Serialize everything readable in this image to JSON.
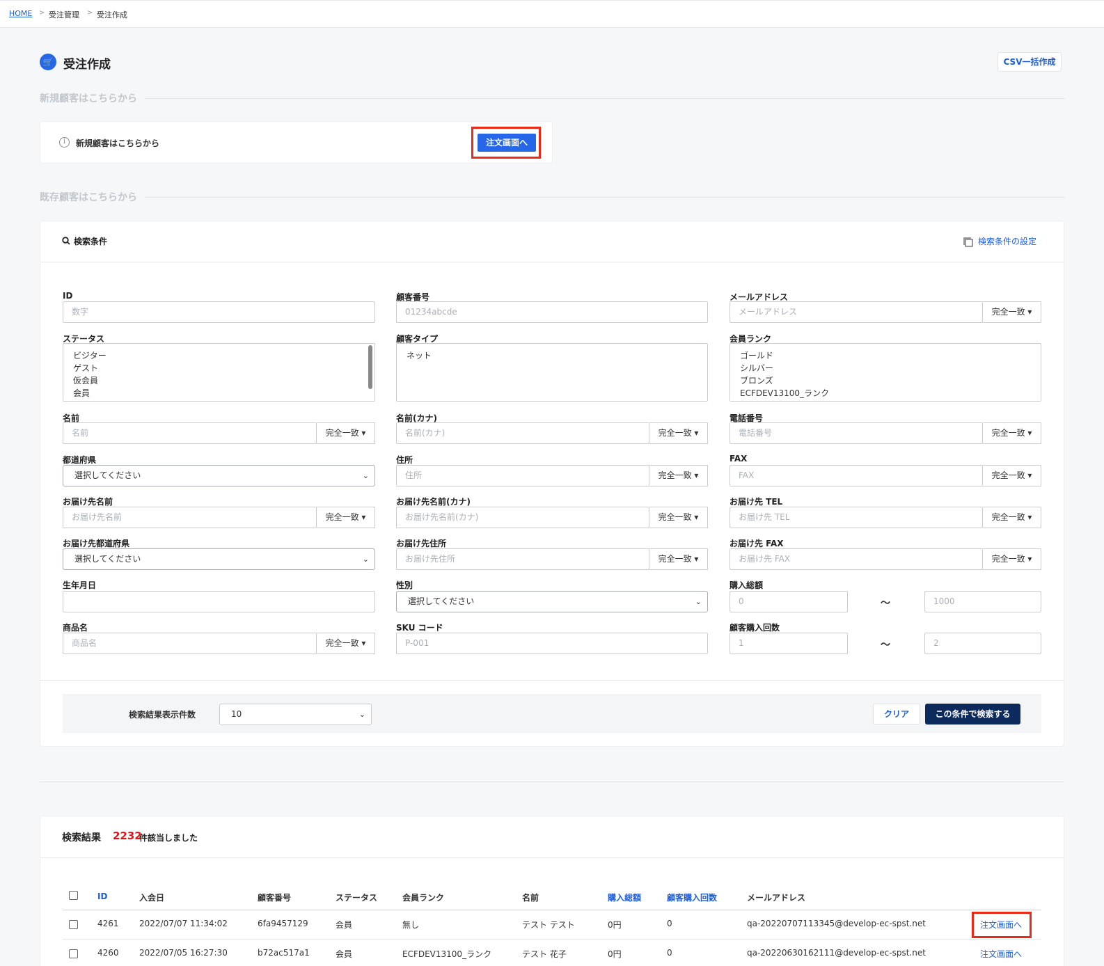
{
  "breadcrumb": {
    "home": "HOME",
    "level1": "受注管理",
    "level2": "受注作成",
    "separator": ">"
  },
  "header": {
    "title": "受注作成",
    "csv_button": "CSV一括作成",
    "icon": "cart-icon"
  },
  "new_customer": {
    "section_label": "新規顧客はこちらから",
    "info_text": "新規顧客はこちらから",
    "order_button": "注文画面へ"
  },
  "existing_customer": {
    "section_label": "既存顧客はこちらから"
  },
  "search": {
    "title": "検索条件",
    "settings_link": "検索条件の設定",
    "match_label": "完全一致",
    "tilde": "〜",
    "fields": {
      "id": {
        "label": "ID",
        "placeholder": "数字"
      },
      "customer_no": {
        "label": "顧客番号",
        "placeholder": "01234abcde"
      },
      "email": {
        "label": "メールアドレス",
        "placeholder": "メールアドレス"
      },
      "status": {
        "label": "ステータス",
        "options": [
          "ビジター",
          "ゲスト",
          "仮会員",
          "会員"
        ]
      },
      "customer_type": {
        "label": "顧客タイプ",
        "options": [
          "ネット"
        ]
      },
      "member_rank": {
        "label": "会員ランク",
        "options": [
          "ゴールド",
          "シルバー",
          "ブロンズ",
          "ECFDEV13100_ランク"
        ]
      },
      "name": {
        "label": "名前",
        "placeholder": "名前"
      },
      "name_kana": {
        "label": "名前(カナ)",
        "placeholder": "名前(カナ)"
      },
      "tel": {
        "label": "電話番号",
        "placeholder": "電話番号"
      },
      "prefecture": {
        "label": "都道府県",
        "value": "選択してください"
      },
      "address": {
        "label": "住所",
        "placeholder": "住所"
      },
      "fax": {
        "label": "FAX",
        "placeholder": "FAX"
      },
      "ship_name": {
        "label": "お届け先名前",
        "placeholder": "お届け先名前"
      },
      "ship_name_kana": {
        "label": "お届け先名前(カナ)",
        "placeholder": "お届け先名前(カナ)"
      },
      "ship_tel": {
        "label": "お届け先 TEL",
        "placeholder": "お届け先 TEL"
      },
      "ship_prefecture": {
        "label": "お届け先都道府県",
        "value": "選択してください"
      },
      "ship_address": {
        "label": "お届け先住所",
        "placeholder": "お届け先住所"
      },
      "ship_fax": {
        "label": "お届け先 FAX",
        "placeholder": "お届け先 FAX"
      },
      "birthday": {
        "label": "生年月日",
        "placeholder": ""
      },
      "gender": {
        "label": "性別",
        "value": "選択してください"
      },
      "total_purchase": {
        "label": "購入総額",
        "from_placeholder": "0",
        "to_placeholder": "1000"
      },
      "product_name": {
        "label": "商品名",
        "placeholder": "商品名"
      },
      "sku": {
        "label": "SKU コード",
        "placeholder": "P-001"
      },
      "purchase_count": {
        "label": "顧客購入回数",
        "from_placeholder": "1",
        "to_placeholder": "2"
      }
    },
    "display_count_label": "検索結果表示件数",
    "display_count_value": "10",
    "clear_button": "クリア",
    "submit_button": "この条件で検索する"
  },
  "results": {
    "title": "検索結果",
    "count": "2232",
    "count_suffix": "件該当しました",
    "columns": [
      "ID",
      "入会日",
      "顧客番号",
      "ステータス",
      "会員ランク",
      "名前",
      "購入総額",
      "顧客購入回数",
      "メールアドレス"
    ],
    "rows": [
      {
        "id": "4261",
        "joined": "2022/07/07 11:34:02",
        "customer_no": "6fa9457129",
        "status": "会員",
        "rank": "無し",
        "name": "テスト テスト",
        "total": "0円",
        "count": "0",
        "email": "qa-20220707113345@develop-ec-spst.net",
        "action": "注文画面へ"
      },
      {
        "id": "4260",
        "joined": "2022/07/05 16:27:30",
        "customer_no": "b72ac517a1",
        "status": "会員",
        "rank": "ECFDEV13100_ランク",
        "name": "テスト 花子",
        "total": "0円",
        "count": "0",
        "email": "qa-20220630162111@develop-ec-spst.net",
        "action": "注文画面へ"
      }
    ]
  },
  "colors": {
    "accent": "#2667e8",
    "navy": "#0d2a5c",
    "highlight": "#ea2a16",
    "count": "#e0151b"
  }
}
